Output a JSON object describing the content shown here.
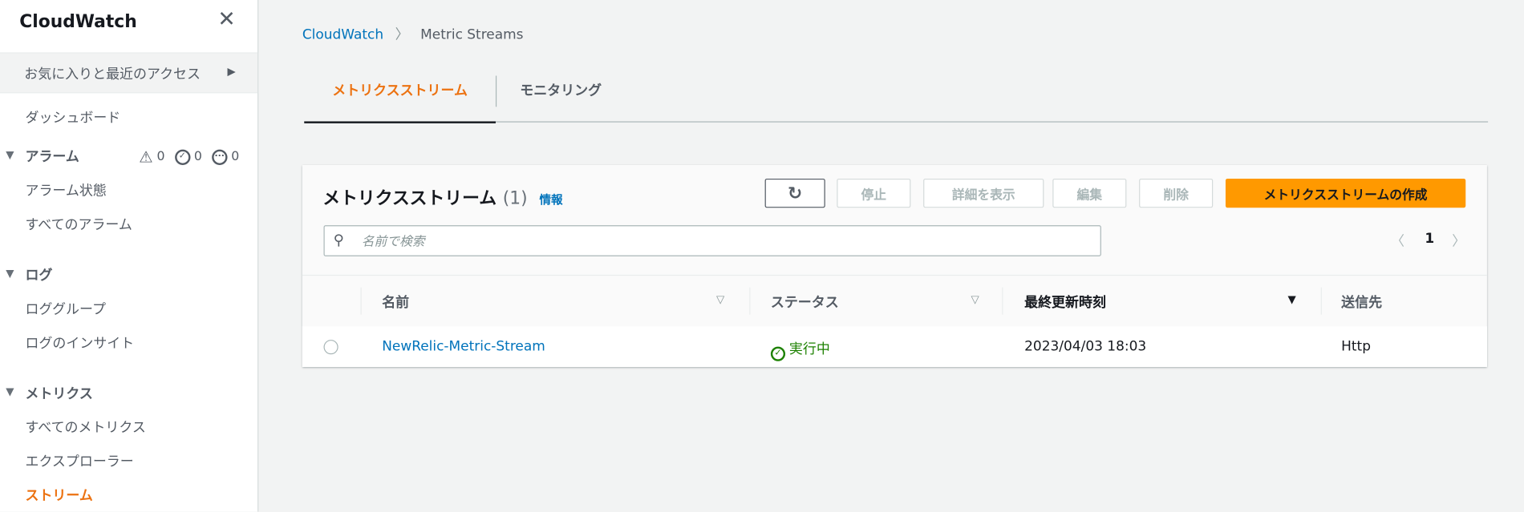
{
  "sidebar": {
    "title": "CloudWatch",
    "favorites": "お気に入りと最近のアクセス",
    "dashboard": "ダッシュボード",
    "alarms": {
      "label": "アラーム",
      "in_alarm": "0",
      "ok": "0",
      "insufficient": "0",
      "items": [
        "アラーム状態",
        "すべてのアラーム"
      ]
    },
    "logs": {
      "label": "ログ",
      "items": [
        "ロググループ",
        "ログのインサイト"
      ]
    },
    "metrics": {
      "label": "メトリクス",
      "items": [
        "すべてのメトリクス",
        "エクスプローラー",
        "ストリーム"
      ]
    }
  },
  "breadcrumb": {
    "root": "CloudWatch",
    "current": "Metric Streams"
  },
  "tabs": [
    "メトリクスストリーム",
    "モニタリング"
  ],
  "panel": {
    "title": "メトリクスストリーム",
    "count": "(1)",
    "info": "情報",
    "buttons": {
      "stop": "停止",
      "details": "詳細を表示",
      "edit": "編集",
      "delete": "削除",
      "create": "メトリクスストリームの作成"
    },
    "search_placeholder": "名前で検索",
    "page": "1",
    "columns": [
      "名前",
      "ステータス",
      "最終更新時刻",
      "送信先"
    ],
    "rows": [
      {
        "name": "NewRelic-Metric-Stream",
        "status": "実行中",
        "updated": "2023/04/03 18:03",
        "destination": "Http"
      }
    ]
  },
  "colors": {
    "accent": "#ec7211",
    "primary_button": "#ff9900",
    "link": "#0073bb",
    "success": "#1d8102"
  }
}
